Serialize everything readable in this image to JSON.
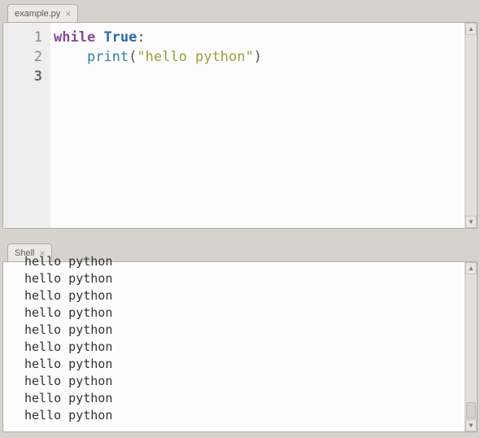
{
  "editor": {
    "tab_label": "example.py",
    "line_numbers": [
      "1",
      "2",
      "3"
    ],
    "current_line_index": 2,
    "code": {
      "line1_kw": "while",
      "line1_bool": "True",
      "line1_colon": ":",
      "line2_indent": "    ",
      "line2_func": "print",
      "line2_open": "(",
      "line2_str": "\"hello python\"",
      "line2_close": ")"
    }
  },
  "shell": {
    "tab_label": "Shell",
    "output_line": "hello python",
    "visible_count": 10
  }
}
